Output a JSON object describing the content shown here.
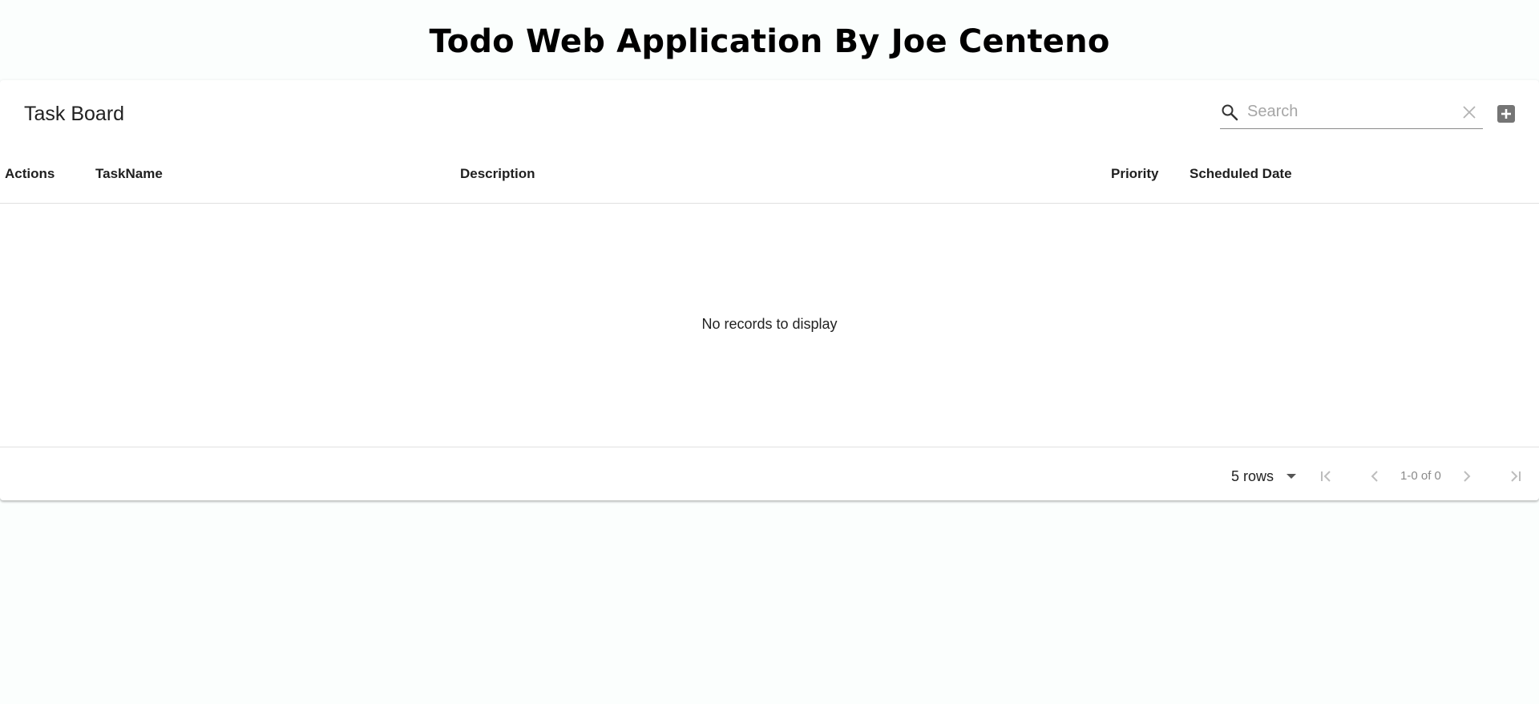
{
  "page": {
    "title": "Todo Web Application By Joe Centeno"
  },
  "toolbar": {
    "title": "Task Board",
    "search_placeholder": "Search",
    "search_value": "",
    "search_icon": "search-icon",
    "clear_icon": "close-icon",
    "add_icon": "add-box-icon"
  },
  "table": {
    "columns": [
      {
        "label": "Actions"
      },
      {
        "label": "TaskName"
      },
      {
        "label": "Description"
      },
      {
        "label": "Priority"
      },
      {
        "label": "Scheduled Date"
      }
    ],
    "rows": [],
    "empty_message": "No records to display"
  },
  "pagination": {
    "rows_per_page_label": "5 rows",
    "page_info": "1-0 of 0",
    "icons": [
      "first-page-icon",
      "previous-page-icon",
      "next-page-icon",
      "last-page-icon"
    ]
  },
  "colors": {
    "page_background": "#fbfefd",
    "icon_grey": "#757575",
    "disabled_grey": "#bdbdbd"
  }
}
